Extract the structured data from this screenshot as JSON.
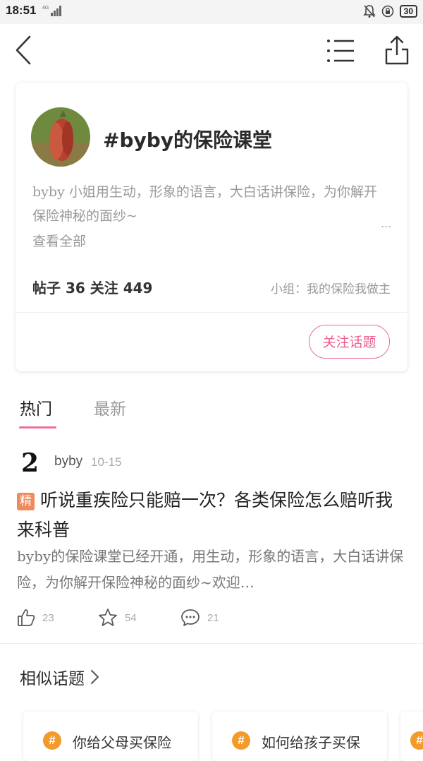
{
  "status": {
    "time": "18:51",
    "network": "4G",
    "battery": "30"
  },
  "topic": {
    "title": "#byby的保险课堂",
    "description": "byby 小姐用生动，形象的语言，大白话讲保险，为你解开保险神秘的面纱~",
    "more": "...",
    "view_all": "查看全部",
    "stats": "帖子 36  关注 449",
    "group": "小组：我的保险我做主",
    "follow_label": "关注话题"
  },
  "tabs": [
    {
      "label": "热门",
      "active": true
    },
    {
      "label": "最新",
      "active": false
    }
  ],
  "post": {
    "avatar_glyph": "2",
    "username": "byby",
    "date": "10-15",
    "badge": "精",
    "title": "听说重疾险只能赔一次？各类保险怎么赔听我来科普",
    "excerpt": "byby的保险课堂已经开通，用生动，形象的语言，大白话讲保险，为你解开保险神秘的面纱~欢迎…",
    "likes": "23",
    "favorites": "54",
    "comments": "21"
  },
  "similar": {
    "title": "相似话题",
    "items": [
      {
        "icon": "#",
        "label": "你给父母买保险"
      },
      {
        "icon": "#",
        "label": "如何给孩子买保"
      },
      {
        "icon": "#",
        "label": ""
      }
    ]
  },
  "colors": {
    "accent": "#ec5f91",
    "badge": "#ef8a5c",
    "hash": "#f49a2b"
  },
  "icons": [
    "back-icon",
    "list-menu-icon",
    "share-icon",
    "like-icon",
    "star-icon",
    "comment-icon",
    "chevron-right-icon",
    "hash-icon"
  ]
}
